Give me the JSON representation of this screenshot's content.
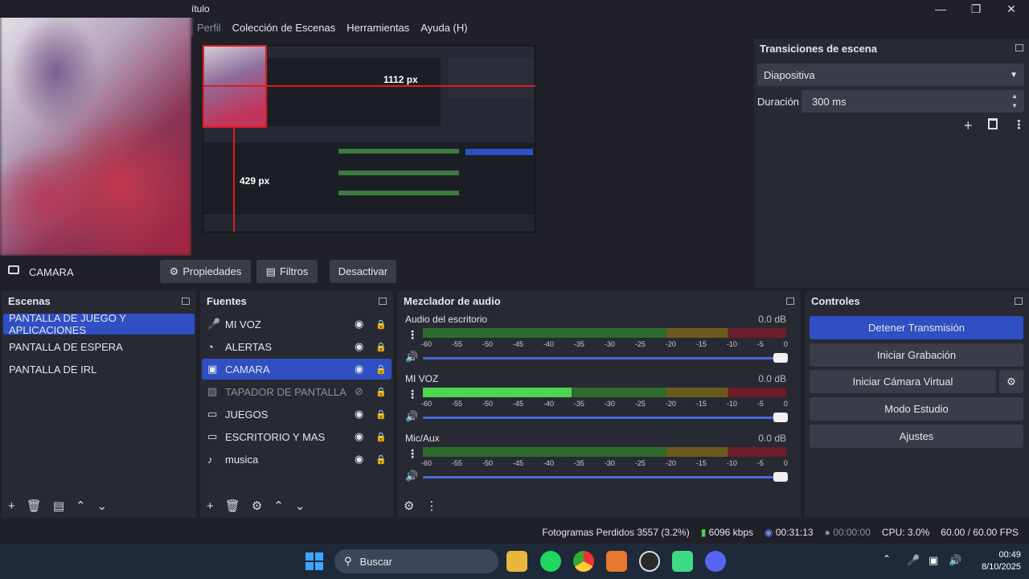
{
  "window": {
    "title": "ítulo"
  },
  "menu": [
    "Perfil",
    "Colección de Escenas",
    "Herramientas",
    "Ayuda (H)"
  ],
  "preview": {
    "width_label": "1112 px",
    "height_label": "429 px"
  },
  "transitions": {
    "title": "Transiciones de escena",
    "selected": "Diapositiva",
    "duration_label": "Duración",
    "duration_value": "300 ms"
  },
  "source_toolbar": {
    "source_name": "CAMARA",
    "properties": "Propiedades",
    "filters": "Filtros",
    "deactivate": "Desactivar"
  },
  "scenes": {
    "title": "Escenas",
    "items": [
      "PANTALLA DE JUEGO Y APLICACIONES",
      "PANTALLA DE ESPERA",
      "PANTALLA DE IRL"
    ],
    "selected_index": 0
  },
  "sources": {
    "title": "Fuentes",
    "items": [
      {
        "name": "MI VOZ",
        "icon": "microphone-icon",
        "visible": true
      },
      {
        "name": "ALERTAS",
        "icon": "globe-icon",
        "visible": true
      },
      {
        "name": "CAMARA",
        "icon": "camera-icon",
        "visible": true
      },
      {
        "name": "TAPADOR DE PANTALLA",
        "icon": "image-icon",
        "visible": false
      },
      {
        "name": "JUEGOS",
        "icon": "gamepad-icon",
        "visible": true
      },
      {
        "name": "ESCRITORIO Y MAS",
        "icon": "monitor-icon",
        "visible": true
      },
      {
        "name": "musica",
        "icon": "speaker-icon",
        "visible": true
      }
    ],
    "selected_index": 2
  },
  "mixer": {
    "title": "Mezclador de audio",
    "ticks": [
      "-60",
      "-55",
      "-50",
      "-45",
      "-40",
      "-35",
      "-30",
      "-25",
      "-20",
      "-15",
      "-10",
      "-5",
      "0"
    ],
    "channels": [
      {
        "name": "Audio del escritorio",
        "db": "0.0 dB",
        "level": 0.0
      },
      {
        "name": "MI VOZ",
        "db": "0.0 dB",
        "level": 0.41
      },
      {
        "name": "Mic/Aux",
        "db": "0.0 dB",
        "level": 0.0
      }
    ]
  },
  "controls": {
    "title": "Controles",
    "stop_stream": "Detener Transmisión",
    "start_recording": "Iniciar Grabación",
    "start_virtual_cam": "Iniciar Cámara Virtual",
    "studio_mode": "Modo Estudio",
    "settings": "Ajustes"
  },
  "status": {
    "dropped_frames": "Fotogramas Perdidos 3557 (3.2%)",
    "bitrate": "6096 kbps",
    "stream_time": "00:31:13",
    "rec_time": "00:00:00",
    "cpu": "CPU: 3.0%",
    "fps": "60.00 / 60.00 FPS"
  },
  "taskbar": {
    "search": "Buscar",
    "time": "00:49",
    "date": "8/10/2025"
  }
}
